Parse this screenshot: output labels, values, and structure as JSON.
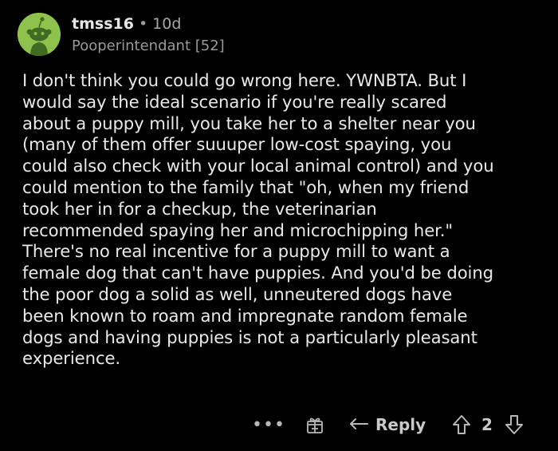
{
  "comment": {
    "username": "tmss16",
    "separator": "•",
    "age": "10d",
    "flair": "Pooperintendant [52]",
    "body_lines": [
      "I don't think you could go wrong here. YWNBTA. But I",
      "would say the ideal scenario if you're really scared",
      "about a puppy mill, you take her to a shelter near you",
      "(many of them offer suuuper low-cost spaying, you",
      "could also check with your local animal control) and you",
      "could mention to the family that \"oh, when my friend",
      "took her in for a checkup, the veterinarian",
      "recommended spaying her and microchipping her.\"",
      "There's no real incentive for a puppy mill to want a",
      "female dog that can't have puppies. And you'd be doing",
      "the poor dog a solid as well, unneutered dogs have",
      "been known to roam and impregnate random female",
      "dogs and having puppies is not a particularly pleasant",
      "experience."
    ]
  },
  "actions": {
    "more_label": "•••",
    "reply_label": "Reply",
    "score": "2"
  },
  "colors": {
    "background": "#000000",
    "avatar_bg": "#8fc24c",
    "text": "#e9e9e9",
    "muted": "#9a9a9a"
  },
  "icons": [
    "snoo-avatar-icon",
    "more-options-icon",
    "award-icon",
    "reply-arrow-icon",
    "upvote-icon",
    "downvote-icon"
  ]
}
